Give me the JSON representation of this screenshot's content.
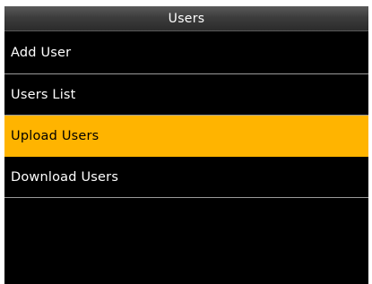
{
  "header": {
    "title": "Users"
  },
  "menu": {
    "items": [
      {
        "label": "Add User",
        "selected": false
      },
      {
        "label": "Users List",
        "selected": false
      },
      {
        "label": "Upload Users",
        "selected": true
      },
      {
        "label": "Download Users",
        "selected": false
      }
    ]
  },
  "colors": {
    "selected_background": "#ffb400",
    "background": "#000000",
    "text": "#ffffff",
    "divider": "#9a9a9a"
  }
}
